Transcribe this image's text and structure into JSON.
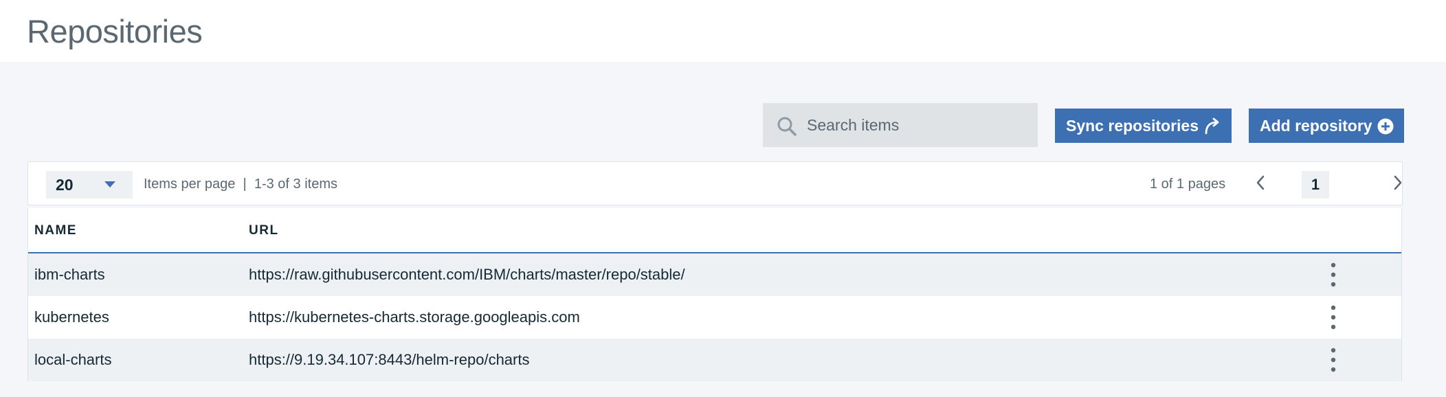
{
  "page": {
    "title": "Repositories"
  },
  "toolbar": {
    "search_placeholder": "Search items",
    "sync_label": "Sync repositories",
    "add_label": "Add repository"
  },
  "pagination": {
    "per_page": "20",
    "items_info": "Items per page  |  1-3 of 3 items",
    "pages_info": "1 of 1 pages",
    "current_page": "1"
  },
  "table": {
    "columns": [
      "NAME",
      "URL"
    ],
    "rows": [
      {
        "name": "ibm-charts",
        "url": "https://raw.githubusercontent.com/IBM/charts/master/repo/stable/"
      },
      {
        "name": "kubernetes",
        "url": "https://kubernetes-charts.storage.googleapis.com"
      },
      {
        "name": "local-charts",
        "url": "https://9.19.34.107:8443/helm-repo/charts"
      }
    ]
  },
  "icons": {
    "search": "search-icon",
    "sync": "sync-arrow-icon",
    "add": "add-circle-icon",
    "caret": "caret-down-icon",
    "prev": "chevron-left-icon",
    "next": "chevron-right-icon",
    "overflow": "overflow-menu-icon"
  },
  "colors": {
    "accent": "#3d70b2",
    "background": "#f4f6f9",
    "row_alt": "#eef1f4",
    "text": "#152935"
  }
}
